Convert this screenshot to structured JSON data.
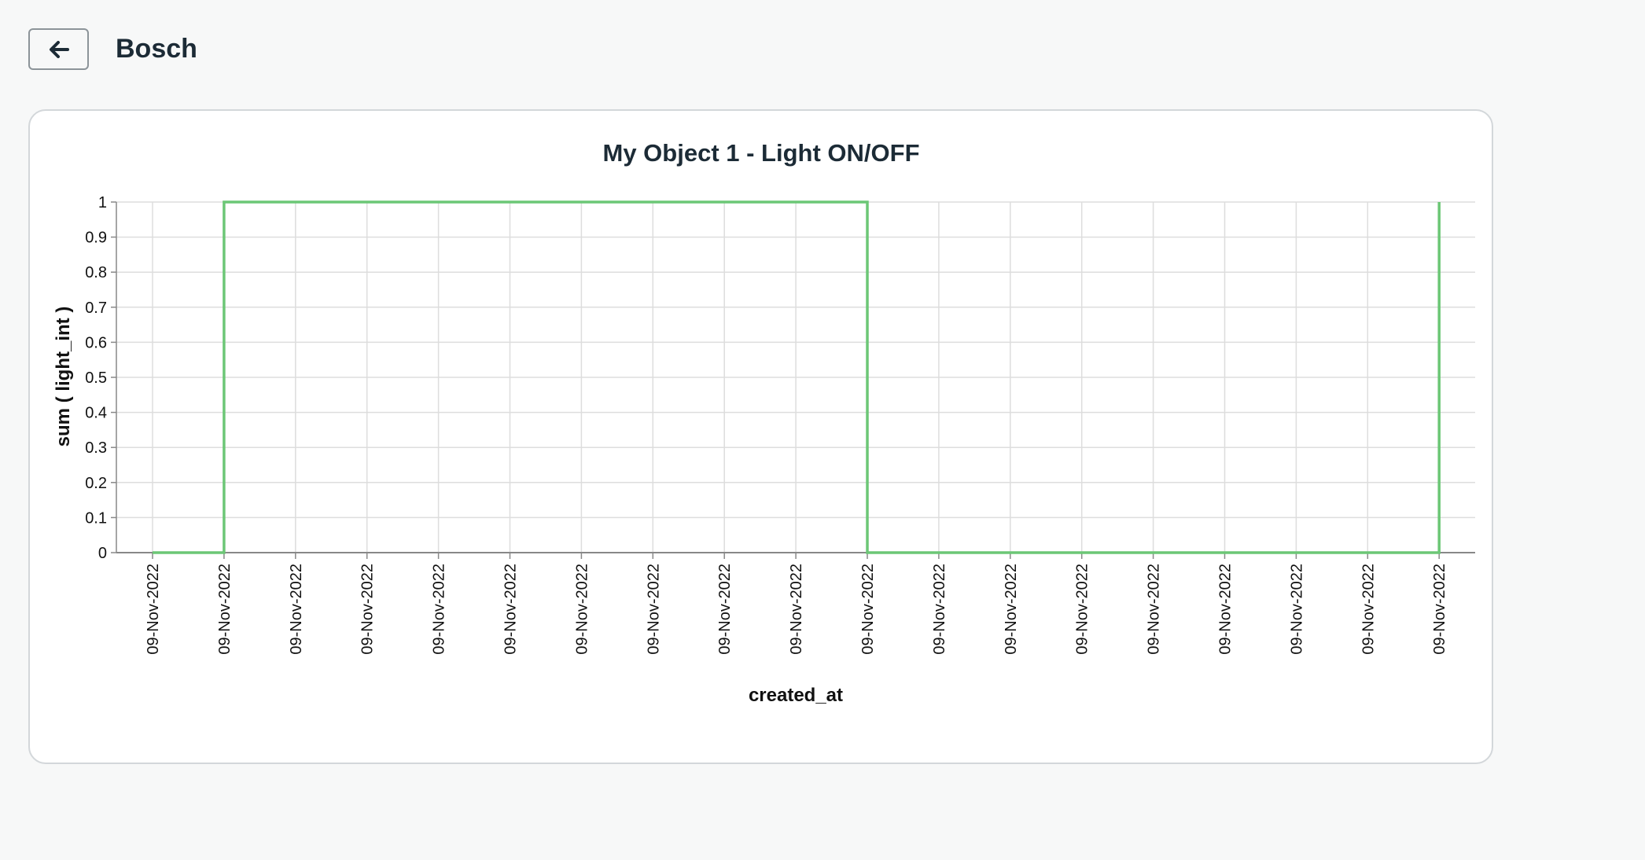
{
  "header": {
    "back_icon": "arrow-left-icon",
    "title": "Bosch"
  },
  "colors": {
    "line": "#6cc776",
    "grid": "#dddddd",
    "axis": "#888888",
    "text": "#1c2b36"
  },
  "chart_data": {
    "type": "line",
    "title": "My Object 1 - Light ON/OFF",
    "xlabel": "created_at",
    "ylabel": "sum ( light_int )",
    "ylim": [
      0,
      1
    ],
    "yticks": [
      "0",
      "0.1",
      "0.2",
      "0.3",
      "0.4",
      "0.5",
      "0.6",
      "0.7",
      "0.8",
      "0.9",
      "1"
    ],
    "grid": true,
    "interpolation": "step",
    "categories": [
      "09-Nov-2022",
      "09-Nov-2022",
      "09-Nov-2022",
      "09-Nov-2022",
      "09-Nov-2022",
      "09-Nov-2022",
      "09-Nov-2022",
      "09-Nov-2022",
      "09-Nov-2022",
      "09-Nov-2022",
      "09-Nov-2022",
      "09-Nov-2022",
      "09-Nov-2022",
      "09-Nov-2022",
      "09-Nov-2022",
      "09-Nov-2022",
      "09-Nov-2022",
      "09-Nov-2022",
      "09-Nov-2022"
    ],
    "values": [
      0,
      1,
      1,
      1,
      1,
      1,
      1,
      1,
      1,
      1,
      0,
      0,
      0,
      0,
      0,
      0,
      0,
      0,
      1
    ]
  }
}
